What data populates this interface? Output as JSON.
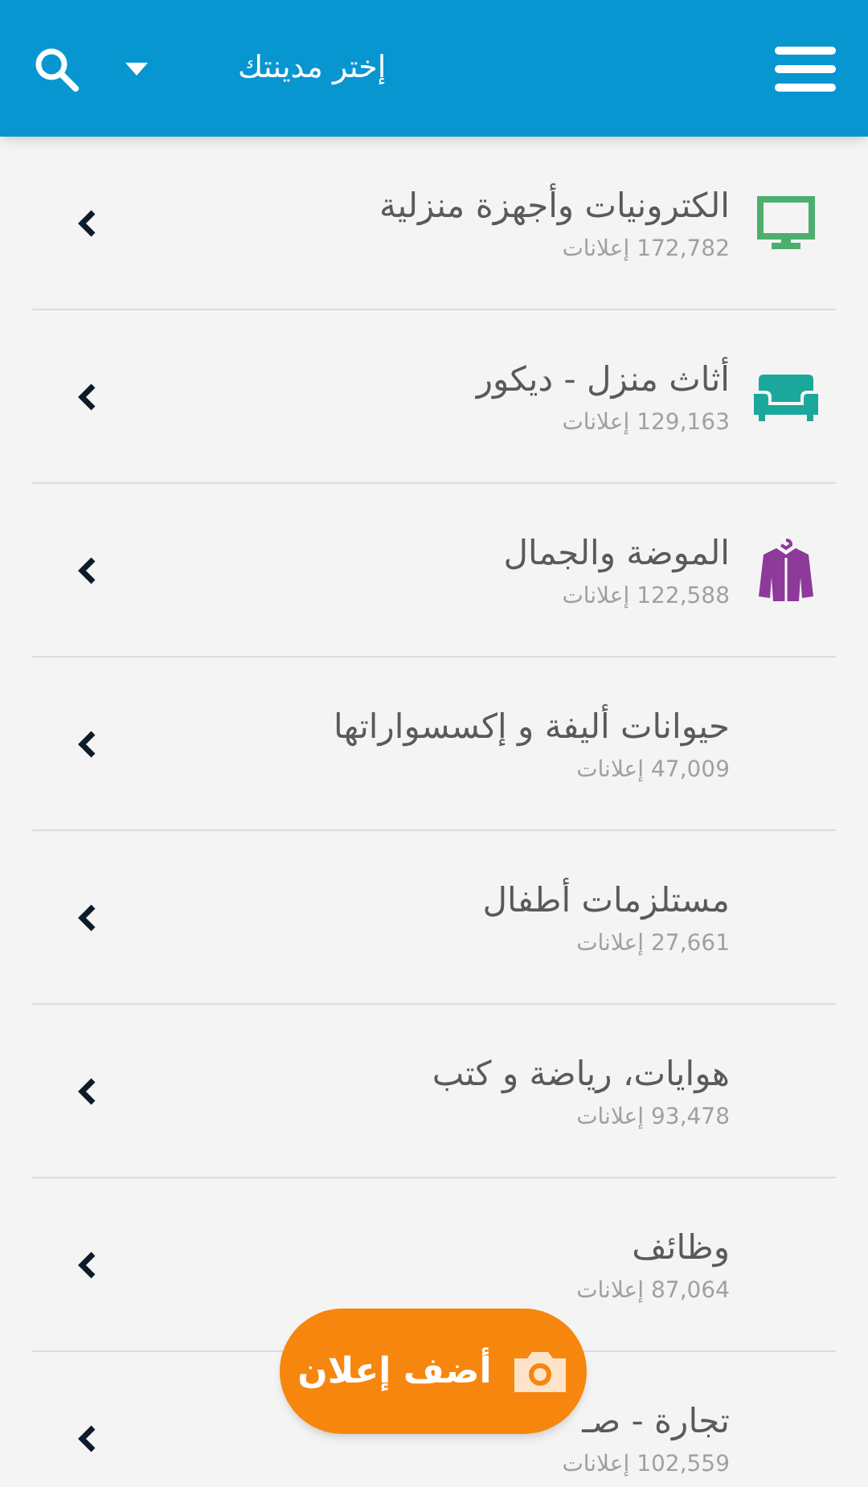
{
  "header": {
    "city_picker": "إختر مدينتك"
  },
  "categories": [
    {
      "title": "الكترونيات وأجهزة منزلية",
      "count": "172,782 إعلانات",
      "color": "#4caf6e"
    },
    {
      "title": "أثاث منزل - ديكور",
      "count": "129,163 إعلانات",
      "color": "#1ba89c"
    },
    {
      "title": "الموضة والجمال",
      "count": "122,588 إعلانات",
      "color": "#8e3a9a"
    },
    {
      "title": "حيوانات أليفة و إكسسواراتها",
      "count": "47,009 إعلانات"
    },
    {
      "title": "مستلزمات أطفال",
      "count": "27,661 إعلانات"
    },
    {
      "title": "هوايات، رياضة و كتب",
      "count": "93,478 إعلانات"
    },
    {
      "title": "وظائف",
      "count": "87,064 إعلانات"
    },
    {
      "title": "تجارة - صـ",
      "count": "102,559 إعلانات"
    }
  ],
  "post_button": {
    "label": "أضف إعلان"
  }
}
